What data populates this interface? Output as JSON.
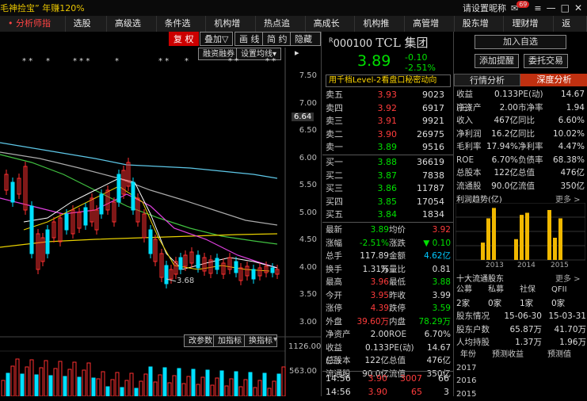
{
  "topbar": {
    "promo": "毛神捡宝”  年赚120%",
    "links": [
      "请设置昵称"
    ],
    "badge": "69",
    "win": [
      "—",
      "□",
      "✕"
    ]
  },
  "menu": [
    {
      "label": "分析师指数",
      "active": true
    },
    {
      "label": "选股器"
    },
    {
      "label": "高级选股"
    },
    {
      "label": "条件选股"
    },
    {
      "label": "机构增仓"
    },
    {
      "label": "热点追击"
    },
    {
      "label": "高成长性"
    },
    {
      "label": "机构推荐"
    },
    {
      "label": "高管增持"
    },
    {
      "label": "股东增持"
    },
    {
      "label": "理财增值"
    },
    {
      "label": "返回"
    }
  ],
  "chart_toolbar": {
    "fuquan": "复 权",
    "diejia": "叠加▽",
    "xian": "画 线",
    "jian": "简 约",
    "yincang": "隐藏▸",
    "rongzi": "融资融券",
    "junxian": "设置均线▾"
  },
  "y_labels": [
    "7.50",
    "7.00",
    "6.50",
    "6.00",
    "5.50",
    "5.00",
    "4.50",
    "4.00",
    "3.50",
    "3.00"
  ],
  "price_tag": "6.64",
  "low_marker": "3.68",
  "vol_labels": [
    "1126.00",
    "563.00"
  ],
  "vol_toolbar": [
    "改参数",
    "加指标",
    "换指标"
  ],
  "stars": [
    "* *",
    "*",
    "* * *",
    "*",
    "* *",
    "*",
    "* *",
    "* *"
  ],
  "stock": {
    "code": "000100",
    "name": "TCL  集团",
    "prefix": "R",
    "price": "3.89",
    "chg": "-0.10",
    "pct": "-2.51%"
  },
  "level2": "用千档Level-2看盘口秘密动向",
  "sell": [
    {
      "l": "卖五",
      "p": "3.93",
      "v": "9023"
    },
    {
      "l": "卖四",
      "p": "3.92",
      "v": "6917"
    },
    {
      "l": "卖三",
      "p": "3.91",
      "v": "9921"
    },
    {
      "l": "卖二",
      "p": "3.90",
      "v": "26975"
    },
    {
      "l": "卖一",
      "p": "3.89",
      "v": "9516"
    }
  ],
  "buy": [
    {
      "l": "买一",
      "p": "3.88",
      "v": "36619"
    },
    {
      "l": "买二",
      "p": "3.87",
      "v": "7838"
    },
    {
      "l": "买三",
      "p": "3.86",
      "v": "11787"
    },
    {
      "l": "买四",
      "p": "3.85",
      "v": "17054"
    },
    {
      "l": "买五",
      "p": "3.84",
      "v": "1834"
    }
  ],
  "stats": [
    [
      {
        "k": "最新",
        "v": "3.89",
        "c": "grn"
      },
      {
        "k": "均价",
        "v": "3.92",
        "c": "red"
      }
    ],
    [
      {
        "k": "涨幅",
        "v": "-2.51%",
        "c": "grn"
      },
      {
        "k": "涨跌",
        "v": "▼ 0.10",
        "c": "grn"
      }
    ],
    [
      {
        "k": "总手",
        "v": "117.89万",
        "c": "wht"
      },
      {
        "k": "金额",
        "v": "4.62亿",
        "c": "cyan"
      }
    ],
    [
      {
        "k": "换手",
        "v": "1.31%",
        "c": "wht"
      },
      {
        "k": "量比",
        "v": "0.81",
        "c": "wht"
      }
    ],
    [
      {
        "k": "最高",
        "v": "3.96",
        "c": "red"
      },
      {
        "k": "最低",
        "v": "3.88",
        "c": "grn"
      }
    ],
    [
      {
        "k": "今开",
        "v": "3.95",
        "c": "red"
      },
      {
        "k": "昨收",
        "v": "3.99",
        "c": "wht"
      }
    ],
    [
      {
        "k": "涨停",
        "v": "4.39",
        "c": "red"
      },
      {
        "k": "跌停",
        "v": "3.59",
        "c": "grn"
      }
    ],
    [
      {
        "k": "外盘",
        "v": "39.60万",
        "c": "red"
      },
      {
        "k": "内盘",
        "v": "78.29万",
        "c": "grn"
      }
    ],
    [
      {
        "k": "净资产",
        "v": "2.00",
        "c": "wht"
      },
      {
        "k": "ROE",
        "v": "6.70%",
        "c": "wht"
      }
    ],
    [
      {
        "k": "收益(三)",
        "v": "0.133",
        "c": "wht"
      },
      {
        "k": "PE(动)",
        "v": "14.67",
        "c": "wht"
      }
    ],
    [
      {
        "k": "总股本",
        "v": "122亿",
        "c": "wht"
      },
      {
        "k": "总值",
        "v": "476亿",
        "c": "wht"
      }
    ],
    [
      {
        "k": "流通股",
        "v": "90.0亿",
        "c": "wht"
      },
      {
        "k": "流值",
        "v": "350亿",
        "c": "wht"
      }
    ]
  ],
  "ticks": [
    {
      "t": "14:56",
      "p": "3.90",
      "v": "3007",
      "n": "66"
    },
    {
      "t": "14:56",
      "p": "3.90",
      "v": "65",
      "n": "3"
    }
  ],
  "fp": {
    "btns": [
      "加入自选",
      "添加提醒",
      "委托交易"
    ],
    "tabs": [
      "行情分析",
      "深度分析"
    ],
    "rows": [
      [
        "收益(三)",
        "0.133",
        "PE(动)",
        "14.67"
      ],
      [
        "净资产",
        "2.00",
        "市净率",
        "1.94"
      ],
      [
        "收入",
        "467亿",
        "同比",
        "6.60%"
      ],
      [
        "净利润",
        "16.2亿",
        "同比",
        "10.02%"
      ],
      [
        "毛利率",
        "17.94%",
        "净利率",
        "4.47%"
      ],
      [
        "ROE",
        "6.70%",
        "负债率",
        "68.38%"
      ],
      [
        "总股本",
        "122亿",
        "总值",
        "476亿"
      ],
      [
        "流通股",
        "90.0亿",
        "流值",
        "350亿"
      ]
    ],
    "trend_title": "利润趋势(亿)",
    "more": "更多 >",
    "trend_years": [
      "2013",
      "2014",
      "2015"
    ],
    "trend_values": [
      2.5,
      6.0,
      7.5,
      3.0,
      6.5,
      6.8,
      7.2,
      3.2,
      6.0
    ],
    "holders_title": "十大流通股东",
    "holders_head": [
      "公募",
      "私募",
      "社保",
      "QFII"
    ],
    "holders_vals": [
      "2家",
      "0家",
      "1家",
      "0家"
    ],
    "holders_rows": [
      [
        "股东情况",
        "15-06-30",
        "15-03-31"
      ],
      [
        "股东户数",
        "65.87万",
        "41.70万"
      ],
      [
        "人均持股",
        "1.37万",
        "1.96万"
      ]
    ],
    "forecast_head": [
      "年份",
      "预测收益",
      "预测值"
    ],
    "forecast_years": [
      "2017",
      "2016",
      "2015"
    ]
  }
}
